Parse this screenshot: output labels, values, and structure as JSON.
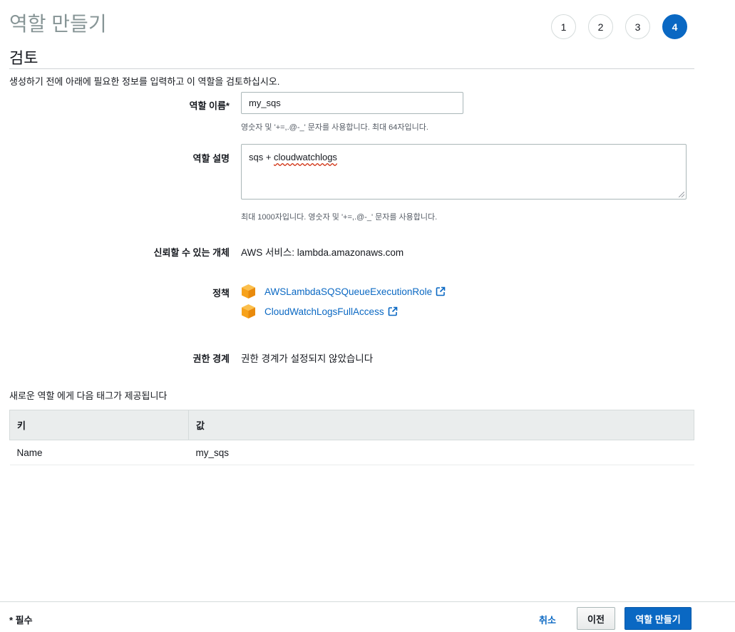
{
  "page": {
    "title": "역할 만들기"
  },
  "steps": [
    {
      "label": "1",
      "active": false
    },
    {
      "label": "2",
      "active": false
    },
    {
      "label": "3",
      "active": false
    },
    {
      "label": "4",
      "active": true
    }
  ],
  "review": {
    "title": "검토",
    "intro": "생성하기 전에 아래에 필요한 정보를 입력하고 이 역할을 검토하십시오."
  },
  "role_name": {
    "label": "역할 이름*",
    "value": "my_sqs",
    "hint": "영숫자 및 '+=,.@-_' 문자를 사용합니다. 최대 64자입니다."
  },
  "role_description": {
    "label": "역할 설명",
    "value_prefix": "sqs + ",
    "value_spell": "cloudwatchlogs",
    "hint": "최대 1000자입니다. 영숫자 및 '+=,.@-_' 문자를 사용합니다."
  },
  "trusted_entity": {
    "label": "신뢰할 수 있는 개체",
    "value": "AWS 서비스: lambda.amazonaws.com"
  },
  "policies": {
    "label": "정책",
    "items": [
      {
        "name": "AWSLambdaSQSQueueExecutionRole",
        "icon": "aws-package-icon"
      },
      {
        "name": "CloudWatchLogsFullAccess",
        "icon": "aws-package-icon"
      }
    ]
  },
  "permissions_boundary": {
    "label": "권한 경계",
    "value": "권한 경계가 설정되지 않았습니다"
  },
  "tags": {
    "note": "새로운 역할 에게 다음 태그가 제공됩니다",
    "columns": [
      "키",
      "값"
    ],
    "rows": [
      [
        "Name",
        "my_sqs"
      ]
    ]
  },
  "footer": {
    "required_note": "* 필수",
    "cancel": "취소",
    "previous": "이전",
    "create": "역할 만들기"
  },
  "colors": {
    "accent": "#0a68c3",
    "policy_icon": "#f7a21b"
  }
}
